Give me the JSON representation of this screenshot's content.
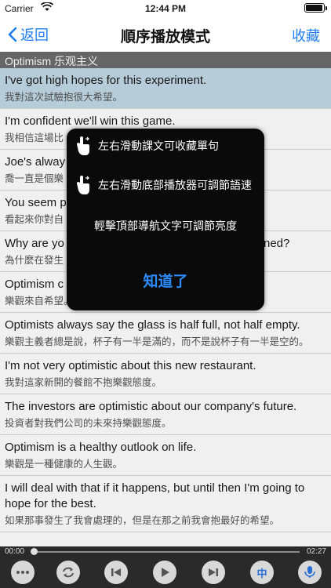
{
  "status": {
    "carrier": "Carrier",
    "time": "12:44 PM"
  },
  "nav": {
    "back_label": "返回",
    "title": "順序播放模式",
    "favorite_label": "收藏"
  },
  "section": {
    "title": "Optimism 乐观主义"
  },
  "sentences": [
    {
      "en": "I've got high hopes for this experiment.",
      "zh": "我對這次試驗抱很大希望。"
    },
    {
      "en": "I'm confident we'll win this game.",
      "zh": "我相信這場比"
    },
    {
      "en": "Joe's alway",
      "zh": "喬一直是個樂"
    },
    {
      "en": "You seem p",
      "zh": "看起來你對自"
    },
    {
      "en": "Why are yo",
      "en_tail": "ned?",
      "zh": "為什麼在發生"
    },
    {
      "en": "Optimism c",
      "zh": "樂觀來自希望。"
    },
    {
      "en": "Optimists always say the glass is half full, not half empty.",
      "zh": "樂觀主義者總是說，杯子有一半是滿的，而不是說杯子有一半是空的。"
    },
    {
      "en": "I'm not very optimistic about this new restaurant.",
      "zh": "我對這家新開的餐館不抱樂觀態度。"
    },
    {
      "en": "The investors are optimistic about our company's future.",
      "zh": "投資者對我們公司的未來持樂觀態度。"
    },
    {
      "en": "Optimism is a healthy outlook on life.",
      "zh": "樂觀是一種健康的人生觀。"
    },
    {
      "en": "I will deal with that if it happens, but until then I'm going to hope for the best.",
      "zh": "如果那事發生了我會處理的，但是在那之前我會抱最好的希望。"
    }
  ],
  "popup": {
    "tips": [
      "左右滑動課文可收藏單句",
      "左右滑動底部播放器可調節語速",
      "輕擊頂部導航文字可調節亮度"
    ],
    "confirm_label": "知道了"
  },
  "player": {
    "current_time": "00:00",
    "total_time": "02:27",
    "progress": 0,
    "controls": [
      "more-icon",
      "repeat-icon",
      "previous-icon",
      "play-icon",
      "next-icon",
      "language-toggle",
      "voice-icon"
    ],
    "language_label": "中"
  }
}
